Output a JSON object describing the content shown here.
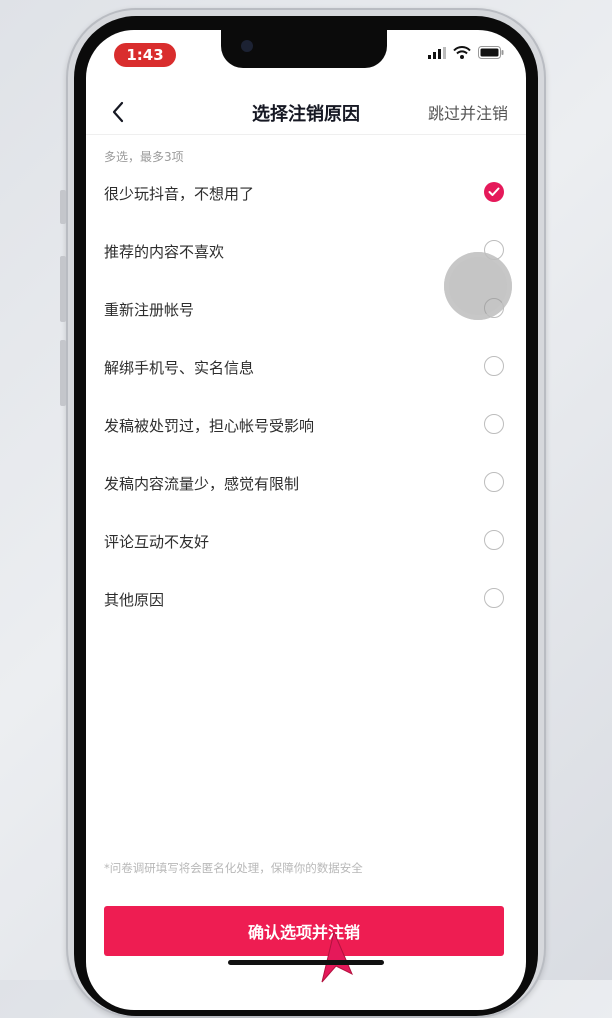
{
  "status_bar": {
    "time": "1:43"
  },
  "nav": {
    "back_icon": "chevron-left-icon",
    "title": "选择注销原因",
    "skip_label": "跳过并注销"
  },
  "hint": "多选，最多3项",
  "options": [
    {
      "label": "很少玩抖音，不想用了",
      "checked": true
    },
    {
      "label": "推荐的内容不喜欢",
      "checked": false
    },
    {
      "label": "重新注册帐号",
      "checked": false
    },
    {
      "label": "解绑手机号、实名信息",
      "checked": false
    },
    {
      "label": "发稿被处罚过，担心帐号受影响",
      "checked": false
    },
    {
      "label": "发稿内容流量少，感觉有限制",
      "checked": false
    },
    {
      "label": "评论互动不友好",
      "checked": false
    },
    {
      "label": "其他原因",
      "checked": false
    }
  ],
  "footer_note": "*问卷调研填写将会匿名化处理，保障你的数据安全",
  "confirm_label": "确认选项并注销",
  "colors": {
    "accent": "#ee1d52",
    "check": "#e5195a",
    "time_pill": "#d92d2d"
  }
}
